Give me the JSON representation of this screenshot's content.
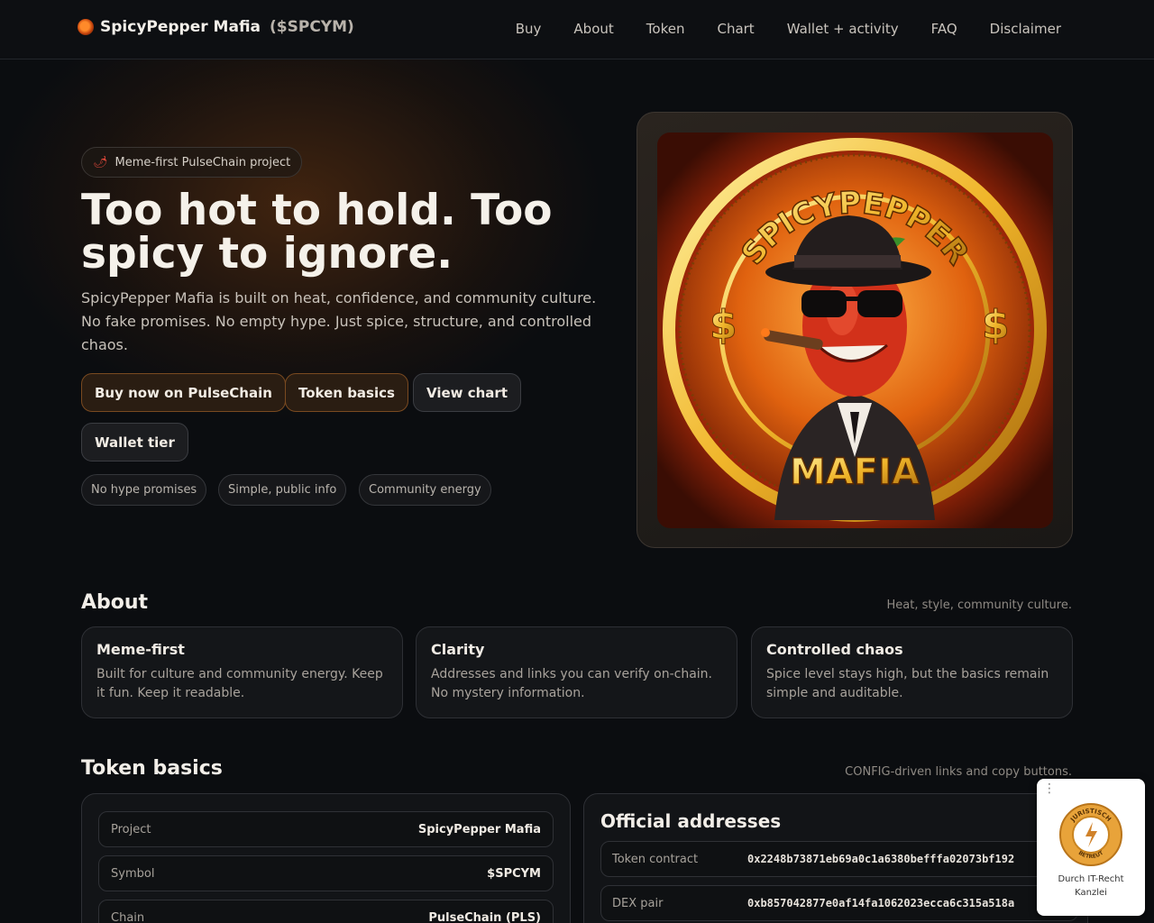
{
  "header": {
    "brand_name": "SpicyPepper Mafia",
    "brand_symbol": "($SPCYM)",
    "nav": [
      "Buy",
      "About",
      "Token",
      "Chart",
      "Wallet + activity",
      "FAQ",
      "Disclaimer"
    ]
  },
  "hero": {
    "pill": "Meme-first PulseChain project",
    "title": "Too hot to hold. Too spicy to ignore.",
    "subtitle": "SpicyPepper Mafia is built on heat, confidence, and community culture. No fake promises. No empty hype. Just spice, structure, and controlled chaos.",
    "buttons": {
      "buy": "Buy now on PulseChain",
      "token": "Token basics",
      "chart": "View chart",
      "wallet": "Wallet tier"
    },
    "tags": [
      "No hype promises",
      "Simple, public info",
      "Community energy"
    ],
    "art": {
      "top_text": "SPICYPEPPER",
      "bottom_text": "MAFIA",
      "left_symbol": "$",
      "right_symbol": "$"
    }
  },
  "about": {
    "title": "About",
    "note": "Heat, style, community culture.",
    "cards": [
      {
        "title": "Meme-first",
        "text": "Built for culture and community energy. Keep it fun. Keep it readable."
      },
      {
        "title": "Clarity",
        "text": "Addresses and links you can verify on-chain. No mystery information."
      },
      {
        "title": "Controlled chaos",
        "text": "Spice level stays high, but the basics remain simple and auditable."
      }
    ]
  },
  "token": {
    "title": "Token basics",
    "note": "CONFIG-driven links and copy buttons.",
    "rows": [
      {
        "k": "Project",
        "v": "SpicyPepper Mafia"
      },
      {
        "k": "Symbol",
        "v": "$SPCYM"
      },
      {
        "k": "Chain",
        "v": "PulseChain (PLS)"
      }
    ],
    "addresses_title": "Official addresses",
    "addresses": [
      {
        "k": "Token contract",
        "v": "0x2248b73871eb69a0c1a6380befffa02073bf192"
      },
      {
        "k": "DEX pair",
        "v": "0xb857042877e0af14fa1062023ecca6c315a518a"
      }
    ]
  },
  "badge": {
    "seal_top": "JURISTISCH",
    "seal_bottom": "BETREUT",
    "line1": "Durch IT-Recht",
    "line2": "Kanzlei"
  }
}
